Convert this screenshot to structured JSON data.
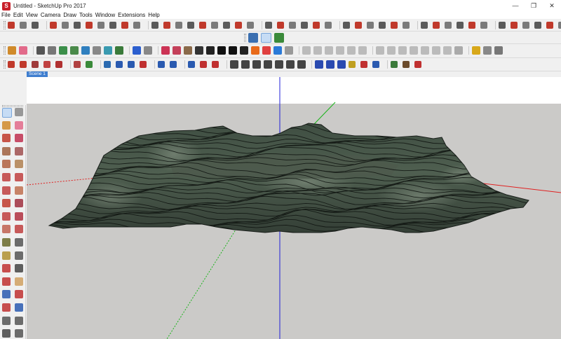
{
  "window": {
    "title": "Untitled - SketchUp Pro 2017",
    "app_icon": "sketchup-icon",
    "controls": [
      "minimize-icon",
      "restore-icon",
      "close-icon"
    ],
    "minimize_glyph": "—",
    "restore_glyph": "❐",
    "close_glyph": "✕"
  },
  "menu": [
    "File",
    "Edit",
    "View",
    "Camera",
    "Draw",
    "Tools",
    "Window",
    "Extensions",
    "Help"
  ],
  "scene": {
    "tab_label": "Scene 1"
  },
  "colors": {
    "sky": "#ffffff",
    "ground": "#cbcac8",
    "axis_red": "#e02020",
    "axis_green": "#18b418",
    "axis_blue": "#2020d8",
    "terrain_dark": "#2c3a2f",
    "terrain_mid": "#4a5a4c",
    "selection": "#c6dcf5"
  }
}
